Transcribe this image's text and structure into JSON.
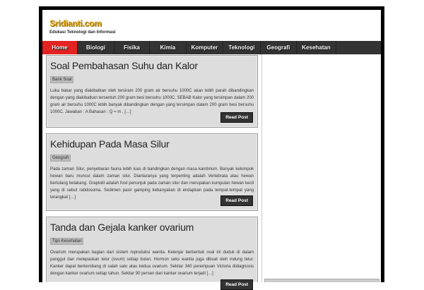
{
  "site": {
    "title": "Sridianti.com",
    "tagline": "Edukasi Teknologi dan Informasi"
  },
  "nav": [
    "Home",
    "Biologi",
    "Fisika",
    "Kimia",
    "Komputer",
    "Teknologi",
    "Geografi",
    "Kesehatan"
  ],
  "posts": [
    {
      "title": "Soal Pembahasan Suhu dan Kalor",
      "category": "Bank Soal",
      "excerpt": "Luka bakar yang diakibatkan oleh tersiram 200 gram air bersuhu 1000C akan lebih parah dibandingkan dengan yang diakibatkan tersentuh 200 gram besi bersuhu 1000C. SEBAB Kalor yang tersimpan dalam 200 gram air bersuhu 1000C lebih banyak dibandingkan dengan yang tersimpan dalam 200 gram besi bersuhu 1000C. Jawaban : A Bahasan : Q = m . […]",
      "read_label": "Read Post"
    },
    {
      "title": "Kehidupan Pada Masa Silur",
      "category": "Geografi",
      "excerpt": "Pada zaman Silur, penyebaran fauna lebih luas di bandingkan dengan masa kambrium. Banyak kelompok hewan baru muncul dalam zaman silur. Diantaranya yang terpenting adalah Vertebrata atau hewan bertulang belakang. Graptolit adalah fosil penunjuk pada zaman silur dan merupakan kumpulan hewan kecil yang di sebut rabdosoma. Sedimen pasir gamping kebanyakan di endapkan pada tempat-tempat yang terangkat […]",
      "read_label": "Read Post"
    },
    {
      "title": "Tanda dan Gejala kanker ovarium",
      "category": "Tips Kesehatan",
      "excerpt": "Ovarium merupakan bagian dari sistem reproduksi wanita. Kelenjar berbentuk oval ini duduk di dalam panggul dan melepaskan telur (ovum) setiap bulan. Hormon seks wanita juga dibuat oleh indung telur. Kanker dapat berkembang di salah satu atau kedua ovarium. Sekitar 340 perempuan Victoria didiagnosis dengan kanker ovarium setiap tahun. Sekitar 90 persen dari kanker ovarium terjadi […]",
      "read_label": "Read Post"
    }
  ]
}
